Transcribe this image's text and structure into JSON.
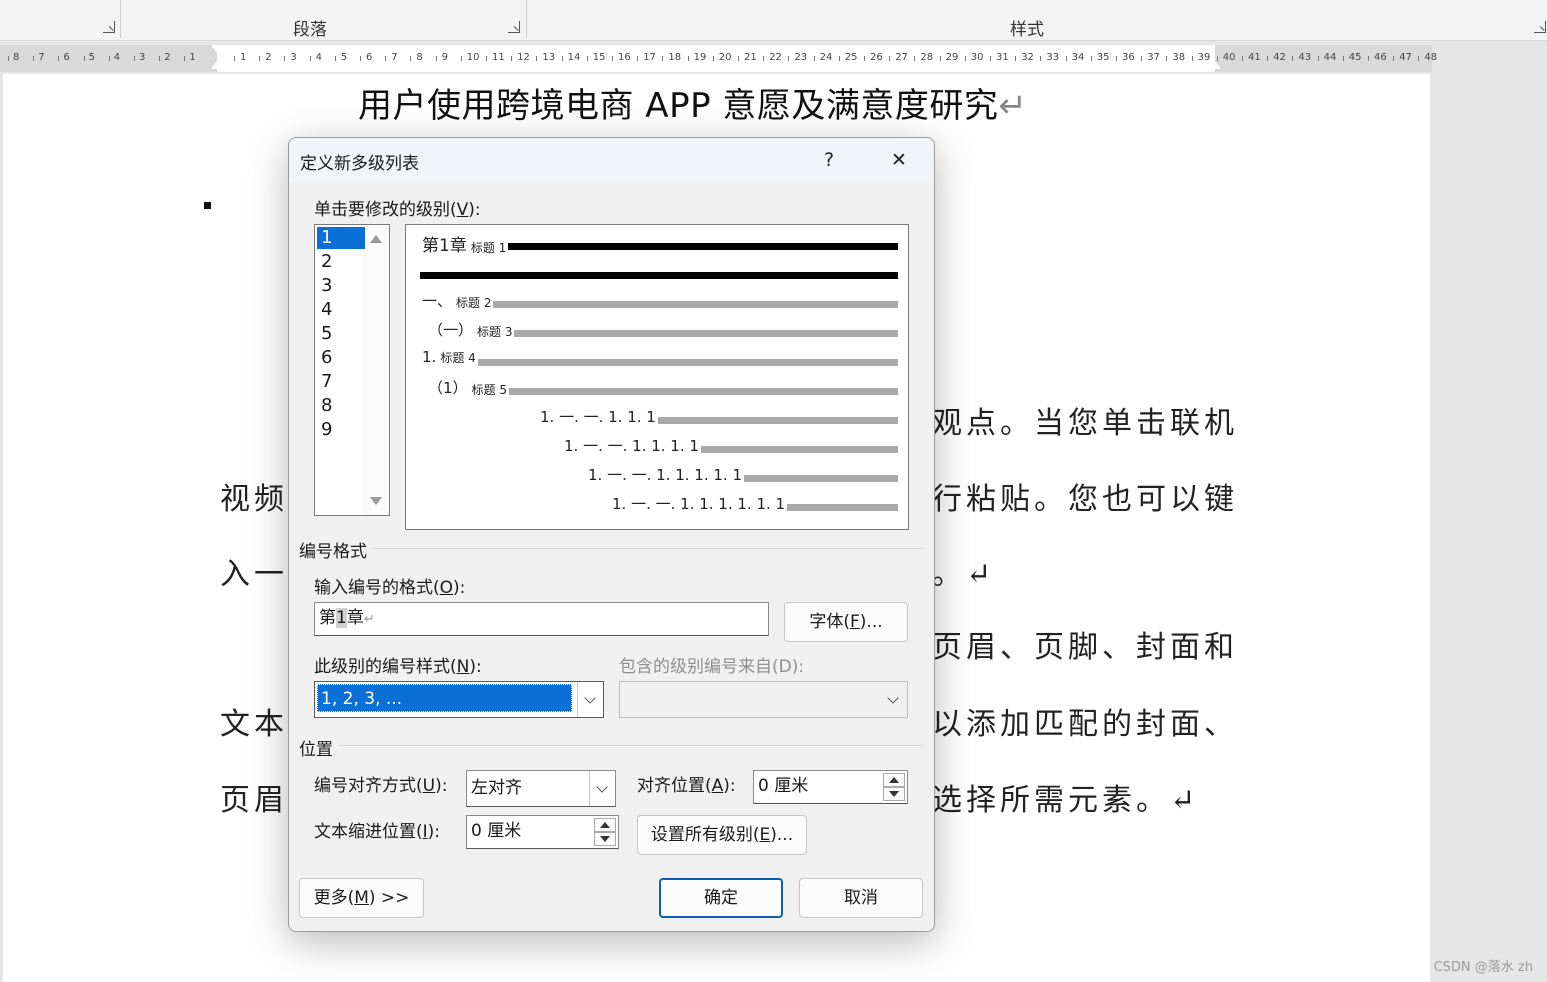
{
  "ribbon": {
    "group_paragraph": "段落",
    "group_styles": "样式"
  },
  "ruler": {
    "left_numbers": [
      "8",
      "7",
      "6",
      "5",
      "4",
      "3",
      "2",
      "1"
    ],
    "right_numbers": [
      "1",
      "2",
      "3",
      "4",
      "5",
      "6",
      "7",
      "8",
      "9",
      "10",
      "11",
      "12",
      "13",
      "14",
      "15",
      "16",
      "17",
      "18",
      "19",
      "20",
      "21",
      "22",
      "23",
      "24",
      "25",
      "26",
      "27",
      "28",
      "29",
      "30",
      "31",
      "32",
      "33",
      "34",
      "35",
      "36",
      "37",
      "38",
      "39",
      "40",
      "41",
      "42",
      "43",
      "44",
      "45",
      "46",
      "47",
      "48"
    ]
  },
  "document": {
    "title": "用户使用跨境电商 APP 意愿及满意度研究",
    "paragraph_mark": "↵",
    "lines": [
      {
        "left": "",
        "right": "观点。当您单击联机"
      },
      {
        "left": "视频",
        "right": "行粘贴。您也可以键"
      },
      {
        "left": "入一",
        "right": "。↵"
      },
      {
        "left": "",
        "right": "页眉、页脚、封面和"
      },
      {
        "left": "文本",
        "right": "以添加匹配的封面、"
      },
      {
        "left": "页眉",
        "right": "选择所需元素。↵"
      }
    ]
  },
  "watermark": "CSDN @落水 zh",
  "dialog": {
    "title": "定义新多级列表",
    "help": "?",
    "close": "✕",
    "level_label": "单击要修改的级别(",
    "level_key": "V",
    "level_label_end": "):",
    "levels": [
      "1",
      "2",
      "3",
      "4",
      "5",
      "6",
      "7",
      "8",
      "9"
    ],
    "selected_level": "1",
    "preview": [
      {
        "num": "第1章",
        "text": "标题 1"
      },
      {
        "num": "一、",
        "text": "标题 2"
      },
      {
        "num": "（一）",
        "text": "标题 3"
      },
      {
        "num": "1.",
        "text": "标题 4"
      },
      {
        "num": "（1）",
        "text": "标题 5"
      },
      {
        "num": "1. 一. 一. 1. 1. 1",
        "text": ""
      },
      {
        "num": "1. 一. 一. 1. 1. 1. 1",
        "text": ""
      },
      {
        "num": "1. 一. 一. 1. 1. 1. 1. 1",
        "text": ""
      },
      {
        "num": "1. 一. 一. 1. 1. 1. 1. 1. 1",
        "text": ""
      }
    ],
    "numbering_format_header": "编号格式",
    "enter_format_label": "输入编号的格式(",
    "enter_format_key": "O",
    "enter_format_label_end": "):",
    "format_value_prefix": "第",
    "format_value_field": "1",
    "format_value_suffix": "章",
    "font_button": "字体(",
    "font_button_key": "F",
    "font_button_end": ")...",
    "number_style_label": "此级别的编号样式(",
    "number_style_key": "N",
    "number_style_label_end": "):",
    "number_style_value": "1, 2, 3, ...",
    "include_level_label": "包含的级别编号来自(D):",
    "include_level_value": "",
    "position_header": "位置",
    "alignment_label": "编号对齐方式(",
    "alignment_key": "U",
    "alignment_label_end": "):",
    "alignment_value": "左对齐",
    "aligned_at_label": "对齐位置(",
    "aligned_at_key": "A",
    "aligned_at_label_end": "):",
    "aligned_at_value": "0 厘米",
    "indent_label": "文本缩进位置(",
    "indent_key": "I",
    "indent_label_end": "):",
    "indent_value": "0 厘米",
    "set_all_levels": "设置所有级别(",
    "set_all_levels_key": "E",
    "set_all_levels_end": ")...",
    "more_button": "更多(",
    "more_button_key": "M",
    "more_button_end": ") >>",
    "ok_button": "确定",
    "cancel_button": "取消"
  }
}
